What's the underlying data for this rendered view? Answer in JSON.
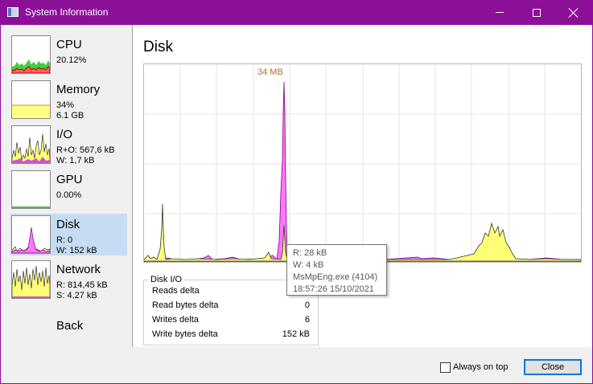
{
  "window": {
    "title": "System Information"
  },
  "sidebar": {
    "items": [
      {
        "label": "CPU",
        "v1": "20.12%",
        "v2": ""
      },
      {
        "label": "Memory",
        "v1": "34%",
        "v2": "6.1 GB"
      },
      {
        "label": "I/O",
        "v1": "R+O: 567,6 kB",
        "v2": "W: 1,7 kB"
      },
      {
        "label": "GPU",
        "v1": "0.00%",
        "v2": ""
      },
      {
        "label": "Disk",
        "v1": "R: 0",
        "v2": "W: 152 kB"
      },
      {
        "label": "Network",
        "v1": "R: 814,45 kB",
        "v2": "S: 4,27 kB"
      }
    ],
    "back_label": "Back"
  },
  "main": {
    "title": "Disk",
    "peak_label": "34 MB",
    "group_title": "Disk I/O",
    "stats": [
      {
        "key": "Reads delta",
        "value": ""
      },
      {
        "key": "Read bytes delta",
        "value": "0"
      },
      {
        "key": "Writes delta",
        "value": "6"
      },
      {
        "key": "Write bytes delta",
        "value": "152 kB"
      }
    ]
  },
  "tooltip": {
    "line1": "R: 28 kB",
    "line2": "W: 4 kB",
    "line3": "MsMpEng.exe (4104)",
    "line4": "18:57:26 15/10/2021"
  },
  "footer": {
    "always_on_top_label": "Always on top",
    "close_label": "Close"
  },
  "colors": {
    "titlebar": "#8c0f98",
    "read": "#ffff77",
    "write": "#ff77ff",
    "selected": "#c5dcf3",
    "cpu_kernel": "#ff4040",
    "cpu_user": "#40d040"
  }
}
